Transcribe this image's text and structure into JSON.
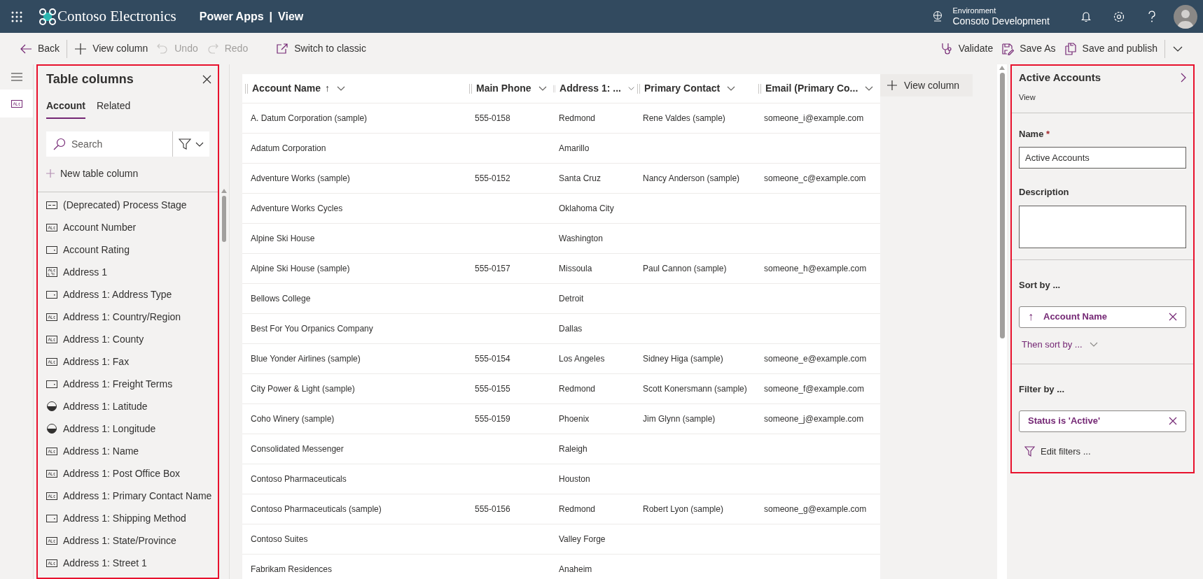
{
  "header": {
    "brand": "Contoso Electronics",
    "app": "Power Apps",
    "separator": "|",
    "page": "View",
    "environment_label": "Environment",
    "environment": "Consoto Development"
  },
  "toolbar": {
    "left": [
      {
        "kind": "back",
        "label": "Back",
        "disabled": false
      },
      {
        "kind": "add",
        "label": "View column",
        "disabled": false
      },
      {
        "kind": "undo",
        "label": "Undo",
        "disabled": true
      },
      {
        "kind": "redo",
        "label": "Redo",
        "disabled": true
      },
      {
        "kind": "classic",
        "label": "Switch to classic",
        "disabled": false
      }
    ],
    "right": [
      {
        "kind": "validate",
        "label": "Validate"
      },
      {
        "kind": "saveas",
        "label": "Save As"
      },
      {
        "kind": "publish",
        "label": "Save and publish"
      }
    ]
  },
  "columns_panel": {
    "title": "Table columns",
    "tabs": [
      {
        "label": "Account",
        "selected": true
      },
      {
        "label": "Related",
        "selected": false
      }
    ],
    "search_placeholder": "Search",
    "new_column": "New table column",
    "items": [
      {
        "kind": "field",
        "label": "(Deprecated) Process Stage"
      },
      {
        "kind": "text",
        "label": "Account Number"
      },
      {
        "kind": "option",
        "label": "Account Rating"
      },
      {
        "kind": "multiline",
        "label": "Address 1"
      },
      {
        "kind": "option",
        "label": "Address 1: Address Type"
      },
      {
        "kind": "text",
        "label": "Address 1: Country/Region"
      },
      {
        "kind": "text",
        "label": "Address 1: County"
      },
      {
        "kind": "text",
        "label": "Address 1: Fax"
      },
      {
        "kind": "option",
        "label": "Address 1: Freight Terms"
      },
      {
        "kind": "decimal",
        "label": "Address 1: Latitude"
      },
      {
        "kind": "decimal",
        "label": "Address 1: Longitude"
      },
      {
        "kind": "text",
        "label": "Address 1: Name"
      },
      {
        "kind": "text",
        "label": "Address 1: Post Office Box"
      },
      {
        "kind": "text",
        "label": "Address 1: Primary Contact Name"
      },
      {
        "kind": "option",
        "label": "Address 1: Shipping Method"
      },
      {
        "kind": "text",
        "label": "Address 1: State/Province"
      },
      {
        "kind": "text",
        "label": "Address 1: Street 1"
      }
    ]
  },
  "table": {
    "columns": [
      {
        "label": "Account Name",
        "sorted": true
      },
      {
        "label": "Main Phone",
        "sorted": false
      },
      {
        "label": "Address 1: ...",
        "sorted": false
      },
      {
        "label": "Primary Contact",
        "sorted": false
      },
      {
        "label": "Email (Primary Co...",
        "sorted": false
      }
    ],
    "sort_arrow": "↑",
    "add_column": "View column",
    "rows": [
      [
        "A. Datum Corporation (sample)",
        "555-0158",
        "Redmond",
        "Rene Valdes (sample)",
        "someone_i@example.com"
      ],
      [
        "Adatum Corporation",
        "",
        "Amarillo",
        "",
        ""
      ],
      [
        "Adventure Works (sample)",
        "555-0152",
        "Santa Cruz",
        "Nancy Anderson (sample)",
        "someone_c@example.com"
      ],
      [
        "Adventure Works Cycles",
        "",
        "Oklahoma City",
        "",
        ""
      ],
      [
        "Alpine Ski House",
        "",
        "Washington",
        "",
        ""
      ],
      [
        "Alpine Ski House (sample)",
        "555-0157",
        "Missoula",
        "Paul Cannon (sample)",
        "someone_h@example.com"
      ],
      [
        "Bellows College",
        "",
        "Detroit",
        "",
        ""
      ],
      [
        "Best For You Orpanics Company",
        "",
        "Dallas",
        "",
        ""
      ],
      [
        "Blue Yonder Airlines (sample)",
        "555-0154",
        "Los Angeles",
        "Sidney Higa (sample)",
        "someone_e@example.com"
      ],
      [
        "City Power & Light (sample)",
        "555-0155",
        "Redmond",
        "Scott Konersmann (sample)",
        "someone_f@example.com"
      ],
      [
        "Coho Winery (sample)",
        "555-0159",
        "Phoenix",
        "Jim Glynn (sample)",
        "someone_j@example.com"
      ],
      [
        "Consolidated Messenger",
        "",
        "Raleigh",
        "",
        ""
      ],
      [
        "Contoso Pharmaceuticals",
        "",
        "Houston",
        "",
        ""
      ],
      [
        "Contoso Pharmaceuticals (sample)",
        "555-0156",
        "Redmond",
        "Robert Lyon (sample)",
        "someone_g@example.com"
      ],
      [
        "Contoso Suites",
        "",
        "Valley Forge",
        "",
        ""
      ],
      [
        "Fabrikam Residences",
        "",
        "Anaheim",
        "",
        ""
      ]
    ]
  },
  "properties": {
    "title": "Active Accounts",
    "subtitle": "View",
    "name_label": "Name",
    "required_mark": "*",
    "name_value": "Active Accounts",
    "description_label": "Description",
    "sort_label": "Sort by ...",
    "sort_arrow": "↑",
    "sort_field": "Account Name",
    "then_sort": "Then sort by ...",
    "filter_label": "Filter by ...",
    "filter": "Status is 'Active'",
    "edit_filters": "Edit filters ..."
  }
}
